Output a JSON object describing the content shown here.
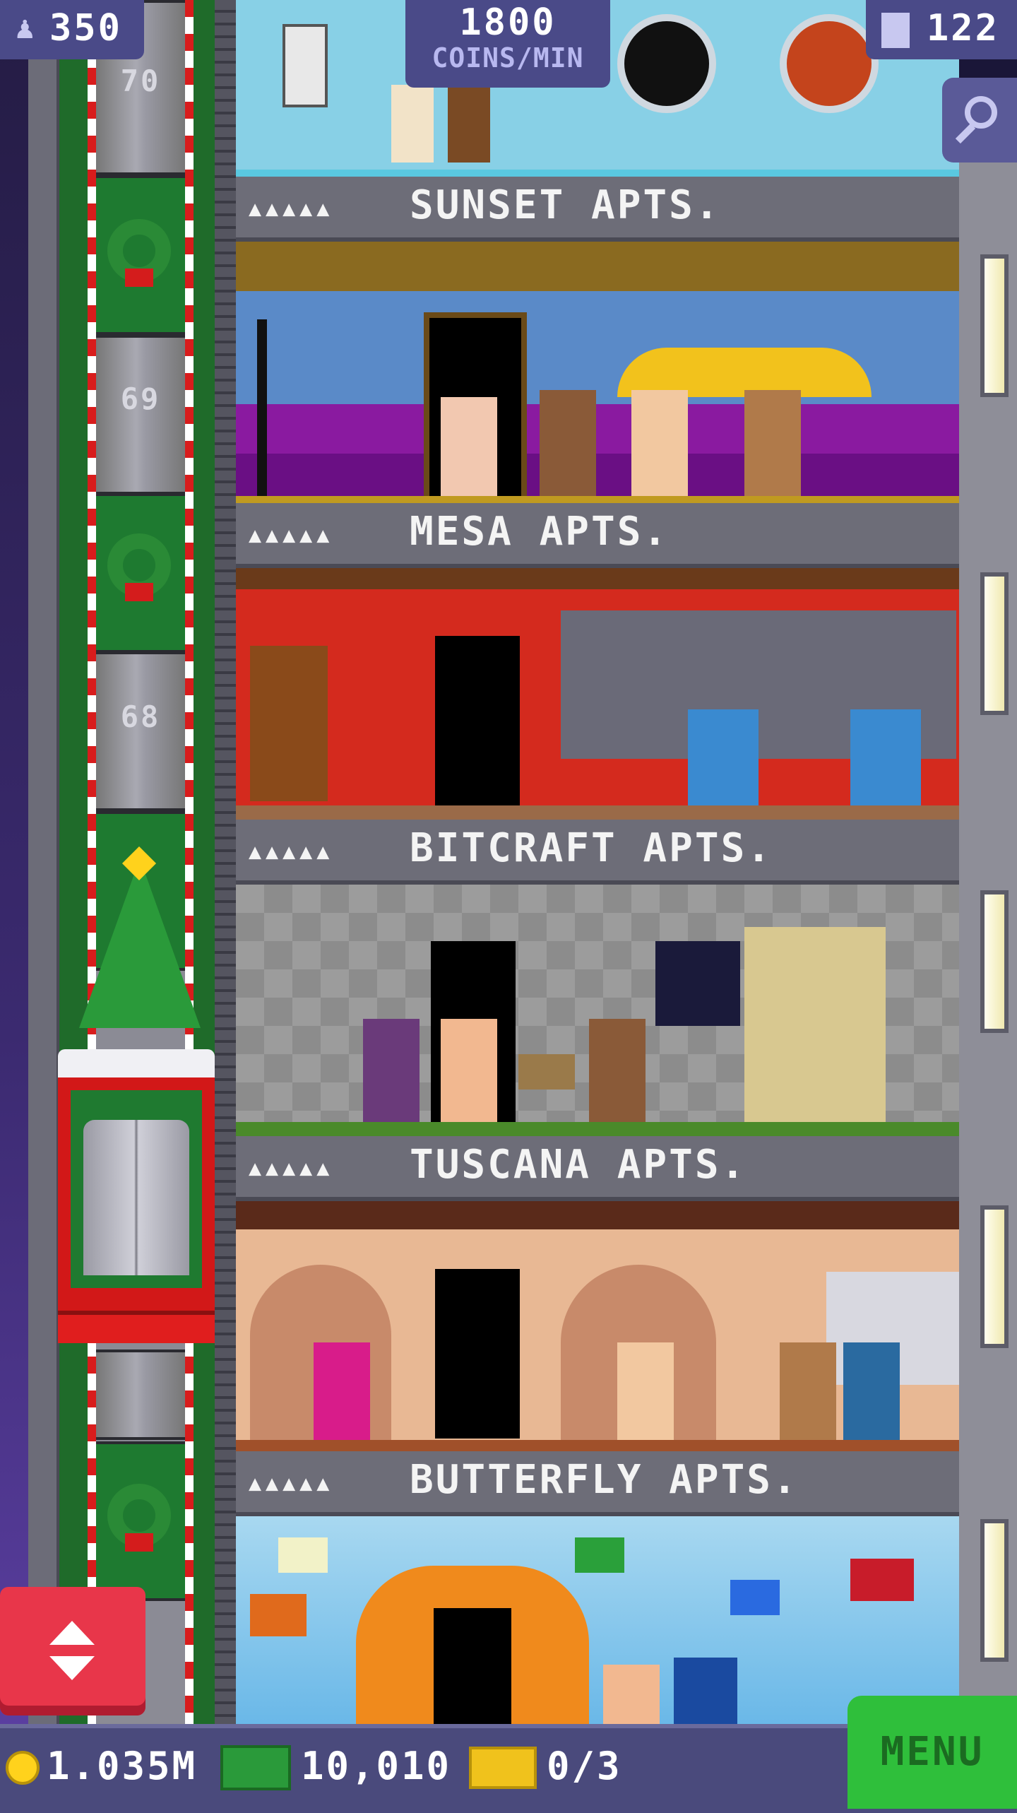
{
  "hud": {
    "population": "350",
    "coins_rate_value": "1800",
    "coins_rate_unit": "COINS/MIN",
    "floors_count": "122"
  },
  "shaft_floor_numbers": [
    "70",
    "69",
    "68"
  ],
  "floors": [
    {
      "name": "SUNSET APTS.",
      "people": "▲▲▲▲▲"
    },
    {
      "name": "MESA APTS.",
      "people": "▲▲▲▲▲"
    },
    {
      "name": "BITCRAFT APTS.",
      "people": "▲▲▲▲▲"
    },
    {
      "name": "TUSCANA APTS.",
      "people": "▲▲▲▲▲"
    },
    {
      "name": "BUTTERFLY APTS.",
      "people": "▲▲▲▲▲"
    }
  ],
  "bottom_bar": {
    "coins": "1.035M",
    "bux": "10,010",
    "tickets": "0/3",
    "menu_label": "MENU"
  },
  "colors": {
    "hud_bg": "#4a4a88",
    "menu_green": "#2fbf3b",
    "elevator_red": "#d21818"
  }
}
